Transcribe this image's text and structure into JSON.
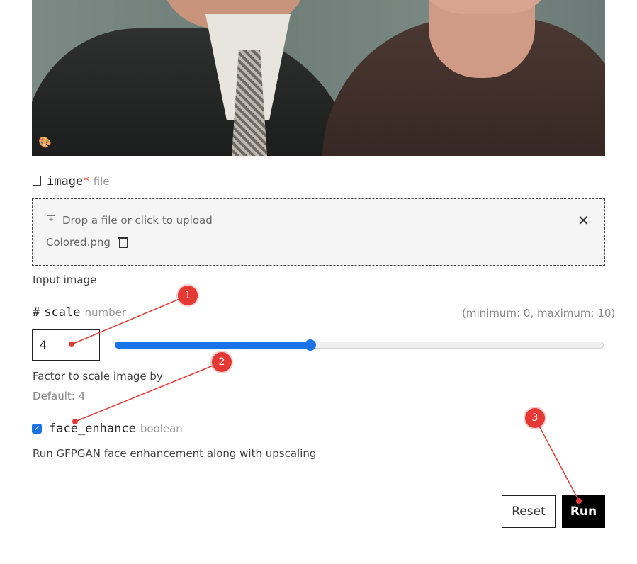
{
  "image_field": {
    "name": "image",
    "required_mark": "*",
    "type": "file",
    "upload_prompt": "Drop a file or click to upload",
    "file_name": "Colored.png",
    "description": "Input image"
  },
  "scale_field": {
    "hash": "#",
    "name": "scale",
    "type": "number",
    "range_note": "(minimum: 0, maximum: 10)",
    "value": "4",
    "min": 0,
    "max": 10,
    "description": "Factor to scale image by",
    "default_text": "Default: 4"
  },
  "face_enhance_field": {
    "name": "face_enhance",
    "type": "boolean",
    "checked": true,
    "description": "Run GFPGAN face enhancement along with upscaling"
  },
  "actions": {
    "reset_label": "Reset",
    "run_label": "Run"
  },
  "annotations": [
    "1",
    "2",
    "3"
  ],
  "colors": {
    "accent": "#1a73e8",
    "annotation": "#e53935",
    "run_bg": "#000000"
  }
}
